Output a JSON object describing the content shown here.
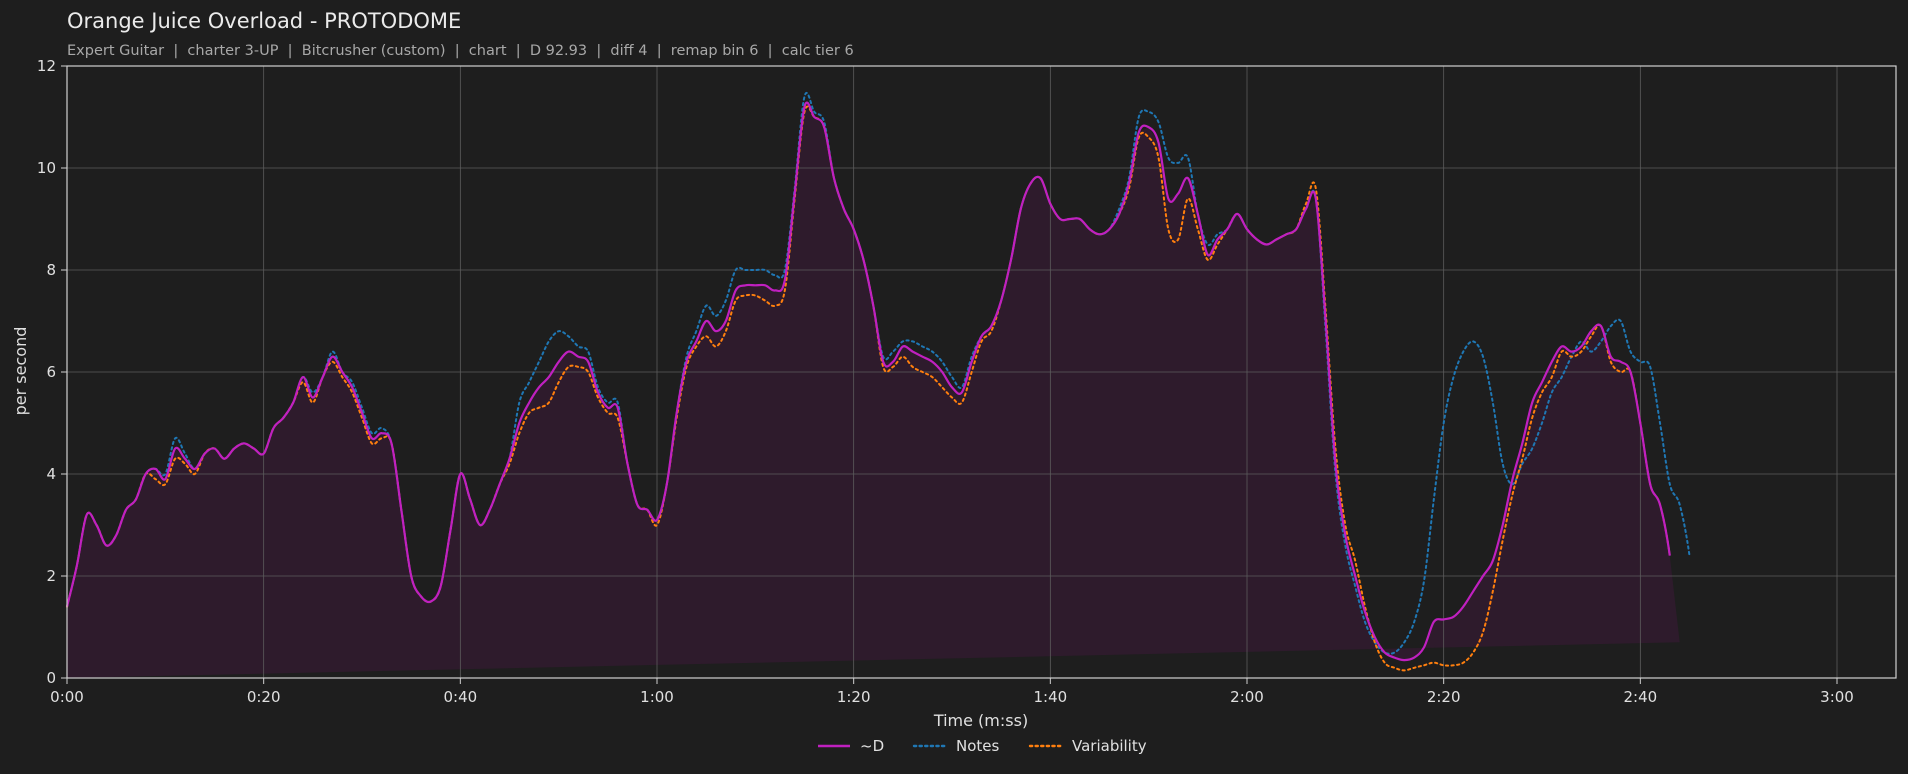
{
  "chart_data": {
    "type": "line",
    "title": "Orange Juice Overload - PROTODOME",
    "subtitle": "Expert Guitar  |  charter 3-UP  |  Bitcrusher (custom)  |  chart  |  D 92.93  |  diff 4  |  remap bin 6  |  calc tier 6",
    "xlabel": "Time (m:ss)",
    "ylabel": "per second",
    "xlim": [
      0,
      186
    ],
    "ylim": [
      0,
      12
    ],
    "xticks": [
      0,
      20,
      40,
      60,
      80,
      100,
      120,
      140,
      160,
      180
    ],
    "xtick_labels": [
      "0:00",
      "0:20",
      "0:40",
      "1:00",
      "1:20",
      "1:40",
      "2:00",
      "2:20",
      "2:40",
      "3:00"
    ],
    "yticks": [
      0,
      2,
      4,
      6,
      8,
      10,
      12
    ],
    "ytick_labels": [
      "0",
      "2",
      "4",
      "6",
      "8",
      "10",
      "12"
    ],
    "grid": true,
    "legend_position": "bottom-center",
    "background_color": "#1e1e1e",
    "x": [
      0,
      1,
      2,
      3,
      4,
      5,
      6,
      7,
      8,
      9,
      10,
      11,
      12,
      13,
      14,
      15,
      16,
      17,
      18,
      19,
      20,
      21,
      22,
      23,
      24,
      25,
      26,
      27,
      28,
      29,
      30,
      31,
      32,
      33,
      34,
      35,
      36,
      37,
      38,
      39,
      40,
      41,
      42,
      43,
      44,
      45,
      46,
      47,
      48,
      49,
      50,
      51,
      52,
      53,
      54,
      55,
      56,
      57,
      58,
      59,
      60,
      61,
      62,
      63,
      64,
      65,
      66,
      67,
      68,
      69,
      70,
      71,
      72,
      73,
      74,
      75,
      76,
      77,
      78,
      79,
      80,
      81,
      82,
      83,
      84,
      85,
      86,
      87,
      88,
      89,
      90,
      91,
      92,
      93,
      94,
      95,
      96,
      97,
      98,
      99,
      100,
      101,
      102,
      103,
      104,
      105,
      106,
      107,
      108,
      109,
      110,
      111,
      112,
      113,
      114,
      115,
      116,
      117,
      118,
      119,
      120,
      121,
      122,
      123,
      124,
      125,
      126,
      127,
      128,
      129,
      130,
      131,
      132,
      133,
      134,
      135,
      136,
      137,
      138,
      139,
      140,
      141,
      142,
      143,
      144,
      145,
      146,
      147,
      148,
      149,
      150,
      151,
      152,
      153,
      154,
      155,
      156,
      157,
      158,
      159,
      160,
      161,
      162,
      163,
      164,
      165,
      166,
      167,
      168,
      169,
      170,
      171,
      172,
      173,
      174,
      175,
      176,
      177,
      178,
      179,
      180,
      181,
      182,
      183,
      184,
      185,
      186
    ],
    "series": [
      {
        "name": "~D",
        "color": "#c020c0",
        "style": "solid",
        "fill": true,
        "fill_color": "#2e1b2c",
        "values": [
          1.4,
          2.2,
          3.2,
          3.0,
          2.6,
          2.8,
          3.3,
          3.5,
          4.0,
          4.1,
          3.9,
          4.5,
          4.3,
          4.1,
          4.4,
          4.5,
          4.3,
          4.5,
          4.6,
          4.5,
          4.4,
          4.9,
          5.1,
          5.4,
          5.9,
          5.5,
          5.9,
          6.3,
          6.0,
          5.7,
          5.2,
          4.7,
          4.8,
          4.6,
          3.3,
          2.0,
          1.6,
          1.5,
          1.8,
          2.9,
          4.0,
          3.5,
          3.0,
          3.3,
          3.8,
          4.3,
          5.0,
          5.4,
          5.7,
          5.9,
          6.2,
          6.4,
          6.3,
          6.2,
          5.6,
          5.3,
          5.3,
          4.2,
          3.4,
          3.3,
          3.1,
          3.8,
          5.2,
          6.2,
          6.6,
          7.0,
          6.8,
          7.0,
          7.6,
          7.7,
          7.7,
          7.7,
          7.6,
          7.8,
          9.5,
          11.2,
          11.0,
          10.8,
          9.8,
          9.2,
          8.8,
          8.2,
          7.3,
          6.2,
          6.2,
          6.5,
          6.4,
          6.3,
          6.2,
          6.0,
          5.7,
          5.6,
          6.2,
          6.7,
          6.9,
          7.4,
          8.2,
          9.2,
          9.7,
          9.8,
          9.3,
          9.0,
          9.0,
          9.0,
          8.8,
          8.7,
          8.8,
          9.1,
          9.7,
          10.7,
          10.8,
          10.5,
          9.4,
          9.5,
          9.8,
          9.1,
          8.3,
          8.6,
          8.8,
          9.1,
          8.8,
          8.6,
          8.5,
          8.6,
          8.7,
          8.8,
          9.2,
          9.4,
          7.0,
          4.2,
          2.8,
          2.0,
          1.3,
          0.8,
          0.5,
          0.4,
          0.35,
          0.4,
          0.6,
          1.1,
          1.15,
          1.2,
          1.4,
          1.7,
          2.0,
          2.3,
          3.0,
          3.9,
          4.6,
          5.4,
          5.8,
          6.2,
          6.5,
          6.4,
          6.5,
          6.8,
          6.9,
          6.3,
          6.2,
          6.0,
          5.0,
          3.8,
          3.4,
          2.4,
          0.7
        ],
        "label": "~D"
      },
      {
        "name": "Notes",
        "color": "#1f77b4",
        "style": "dotted",
        "values": [
          1.4,
          2.2,
          3.2,
          3.0,
          2.6,
          2.8,
          3.3,
          3.5,
          4.0,
          4.1,
          4.0,
          4.7,
          4.4,
          4.1,
          4.4,
          4.5,
          4.3,
          4.5,
          4.6,
          4.5,
          4.4,
          4.9,
          5.1,
          5.4,
          5.9,
          5.6,
          5.9,
          6.4,
          6.0,
          5.8,
          5.3,
          4.8,
          4.9,
          4.6,
          3.3,
          2.0,
          1.6,
          1.5,
          1.8,
          2.9,
          4.0,
          3.5,
          3.0,
          3.3,
          3.8,
          4.3,
          5.4,
          5.8,
          6.2,
          6.6,
          6.8,
          6.7,
          6.5,
          6.4,
          5.7,
          5.4,
          5.4,
          4.2,
          3.4,
          3.3,
          3.1,
          3.8,
          5.2,
          6.3,
          6.8,
          7.3,
          7.1,
          7.4,
          8.0,
          8.0,
          8.0,
          8.0,
          7.9,
          8.0,
          9.6,
          11.4,
          11.1,
          10.9,
          9.8,
          9.2,
          8.8,
          8.2,
          7.3,
          6.3,
          6.4,
          6.6,
          6.6,
          6.5,
          6.4,
          6.2,
          5.9,
          5.7,
          6.3,
          6.7,
          6.9,
          7.4,
          8.2,
          9.2,
          9.7,
          9.8,
          9.3,
          9.0,
          9.0,
          9.0,
          8.8,
          8.7,
          8.8,
          9.2,
          9.8,
          11.0,
          11.1,
          10.9,
          10.2,
          10.1,
          10.2,
          9.1,
          8.5,
          8.7,
          8.8,
          9.1,
          8.8,
          8.6,
          8.5,
          8.6,
          8.7,
          8.8,
          9.2,
          9.4,
          6.8,
          4.0,
          2.6,
          1.8,
          1.1,
          0.7,
          0.5,
          0.5,
          0.7,
          1.1,
          1.9,
          3.5,
          5.0,
          5.9,
          6.4,
          6.6,
          6.3,
          5.4,
          4.2,
          3.8,
          4.2,
          4.5,
          5.0,
          5.6,
          5.9,
          6.3,
          6.6,
          6.4,
          6.6,
          6.9,
          7.0,
          6.4,
          6.2,
          6.1,
          5.0,
          3.8,
          3.4,
          2.4,
          0.7
        ],
        "label": "Notes"
      },
      {
        "name": "Variability",
        "color": "#ff7f0e",
        "style": "dotted",
        "values": [
          1.4,
          2.2,
          3.2,
          3.0,
          2.6,
          2.8,
          3.3,
          3.5,
          4.0,
          3.9,
          3.8,
          4.3,
          4.2,
          4.0,
          4.4,
          4.5,
          4.3,
          4.5,
          4.6,
          4.5,
          4.4,
          4.9,
          5.1,
          5.4,
          5.8,
          5.4,
          5.9,
          6.2,
          5.9,
          5.6,
          5.1,
          4.6,
          4.7,
          4.6,
          3.3,
          2.0,
          1.6,
          1.5,
          1.8,
          2.9,
          4.0,
          3.5,
          3.0,
          3.3,
          3.8,
          4.2,
          4.8,
          5.2,
          5.3,
          5.4,
          5.8,
          6.1,
          6.1,
          6.0,
          5.5,
          5.2,
          5.1,
          4.2,
          3.4,
          3.3,
          3.0,
          3.8,
          5.1,
          6.1,
          6.5,
          6.7,
          6.5,
          6.8,
          7.4,
          7.5,
          7.5,
          7.4,
          7.3,
          7.6,
          9.4,
          11.1,
          11.0,
          10.8,
          9.8,
          9.2,
          8.8,
          8.2,
          7.3,
          6.1,
          6.1,
          6.3,
          6.1,
          6.0,
          5.9,
          5.7,
          5.5,
          5.4,
          6.0,
          6.6,
          6.8,
          7.4,
          8.2,
          9.2,
          9.7,
          9.8,
          9.3,
          9.0,
          9.0,
          9.0,
          8.8,
          8.7,
          8.8,
          9.1,
          9.6,
          10.6,
          10.6,
          10.2,
          8.8,
          8.6,
          9.4,
          8.8,
          8.2,
          8.5,
          8.8,
          9.1,
          8.8,
          8.6,
          8.5,
          8.6,
          8.7,
          8.8,
          9.3,
          9.6,
          7.2,
          4.5,
          3.0,
          2.3,
          1.4,
          0.7,
          0.3,
          0.2,
          0.15,
          0.2,
          0.25,
          0.3,
          0.25,
          0.25,
          0.3,
          0.5,
          0.9,
          1.7,
          2.7,
          3.6,
          4.3,
          5.1,
          5.6,
          5.9,
          6.4,
          6.3,
          6.4,
          6.7,
          6.9,
          6.2,
          6.0,
          6.0,
          5.0,
          3.8,
          3.4,
          2.4,
          0.7
        ],
        "label": "Variability"
      }
    ]
  }
}
